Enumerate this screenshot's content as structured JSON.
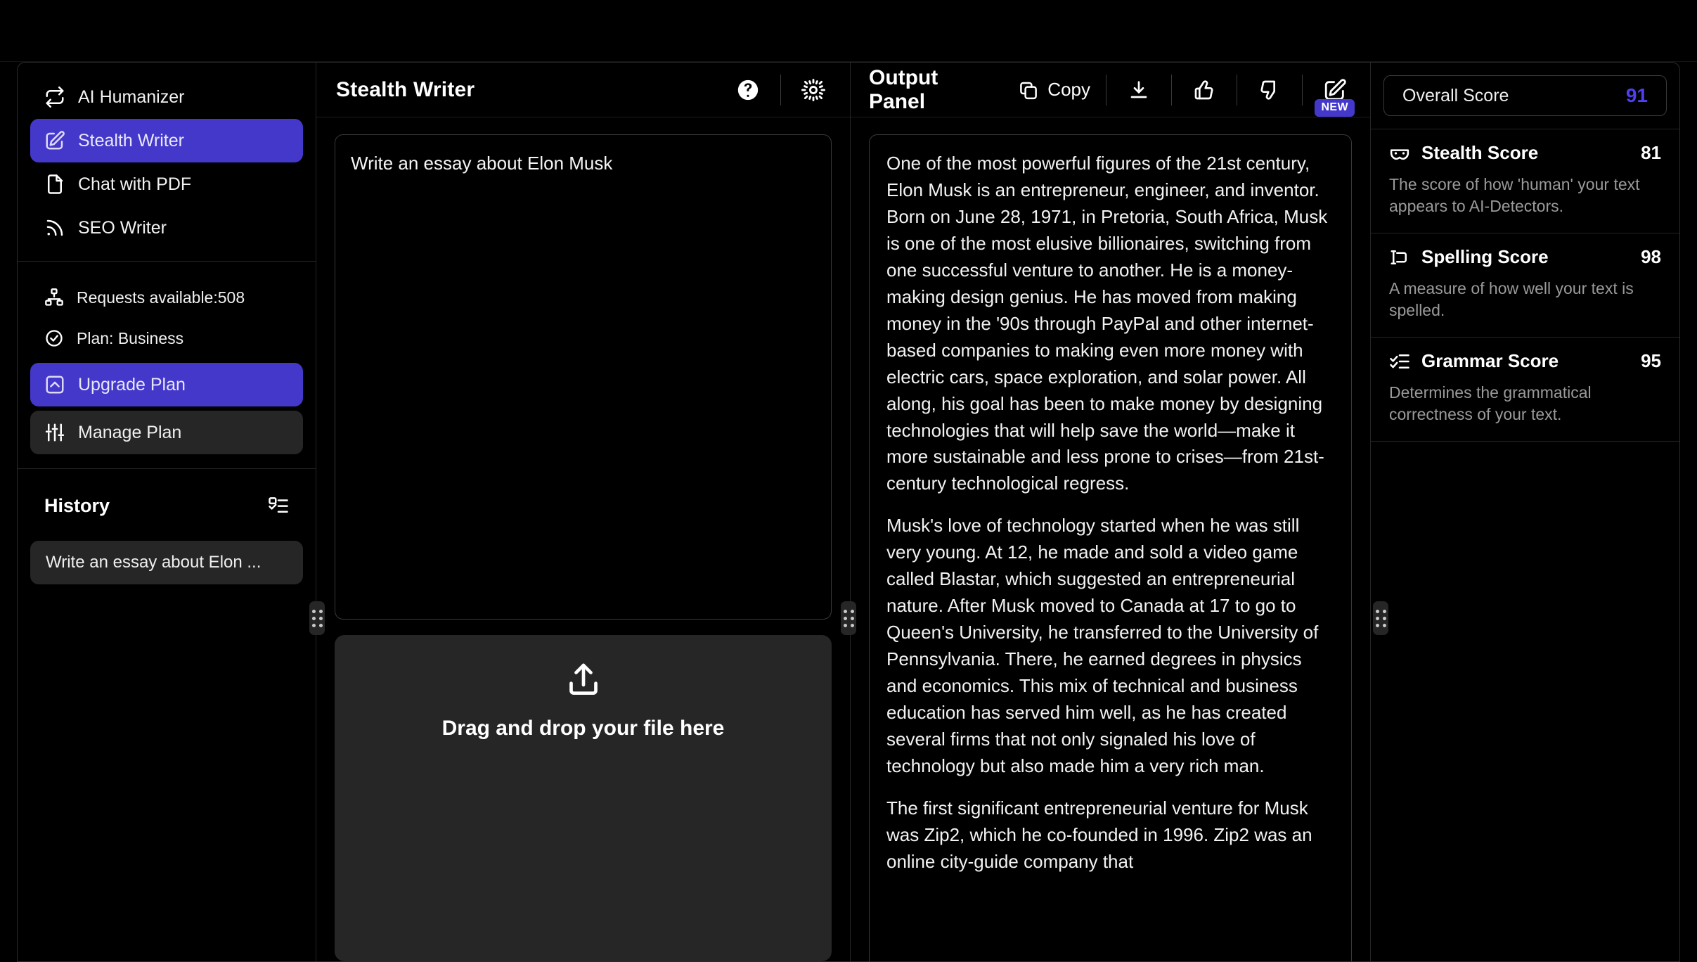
{
  "sidebar": {
    "nav_items": [
      {
        "label": "AI Humanizer",
        "icon": "repeat-icon",
        "active": false
      },
      {
        "label": "Stealth Writer",
        "icon": "edit-square-icon",
        "active": true
      },
      {
        "label": "Chat with PDF",
        "icon": "file-icon",
        "active": false
      },
      {
        "label": "SEO Writer",
        "icon": "rss-icon",
        "active": false
      }
    ],
    "meta_items": [
      {
        "label": "Requests available:508",
        "icon": "network-icon"
      },
      {
        "label": "Plan: Business",
        "icon": "check-circle-icon"
      }
    ],
    "upgrade_label": "Upgrade Plan",
    "manage_label": "Manage Plan",
    "history": {
      "title": "History",
      "list_icon": "list-check-icon",
      "items": [
        {
          "label": "Write an essay about Elon ..."
        }
      ]
    }
  },
  "middle": {
    "title": "Stealth Writer",
    "help_icon": "help-circle-icon",
    "settings_icon": "gear-icon",
    "input_value": "Write an essay about Elon Musk",
    "input_placeholder": "Write an essay about Elon Musk",
    "dropzone_label": "Drag and drop your file here",
    "dropzone_icon": "upload-icon"
  },
  "output": {
    "title": "Output Panel",
    "copy_label": "Copy",
    "copy_icon": "copy-icon",
    "download_icon": "download-icon",
    "thumbs_up_icon": "thumbs-up-icon",
    "thumbs_down_icon": "thumbs-down-icon",
    "edit_icon": "edit-square-icon",
    "new_badge": "NEW",
    "paragraphs": [
      "One of the most powerful figures of the 21st century, Elon Musk is an entrepreneur, engineer, and inventor. Born on June 28, 1971, in Pretoria, South Africa, Musk is one of the most elusive billionaires, switching from one successful venture to another. He is a money-making design genius. He has moved from making money in the '90s through PayPal and other internet-based companies to making even more money with electric cars, space exploration, and solar power. All along, his goal has been to make money by designing technologies that will help save the world—make it more sustainable and less prone to crises—from 21st-century technological regress.",
      "Musk's love of technology started when he was still very young. At 12, he made and sold a video game called Blastar, which suggested an entrepreneurial nature. After Musk moved to Canada at 17 to go to Queen's University, he transferred to the University of Pennsylvania. There, he earned degrees in physics and economics. This mix of technical and business education has served him well, as he has created several firms that not only signaled his love of technology but also made him a very rich man.",
      "The first significant entrepreneurial venture for Musk was Zip2, which he co-founded in 1996. Zip2 was an online city-guide company that"
    ]
  },
  "scores": {
    "overall_label": "Overall Score",
    "overall_value": "91",
    "overall_color": "#4e3ff0",
    "items": [
      {
        "name": "Stealth Score",
        "value": "81",
        "icon": "mask-icon",
        "description": "The score of how 'human' your text appears to AI-Detectors."
      },
      {
        "name": "Spelling Score",
        "value": "98",
        "icon": "spellcheck-icon",
        "description": "A measure of how well your text is spelled."
      },
      {
        "name": "Grammar Score",
        "value": "95",
        "icon": "list-check-icon",
        "description": "Determines the grammatical correctness of your text."
      }
    ]
  },
  "theme": {
    "accent": "#4438ca",
    "background": "#000000",
    "surface": "#262626",
    "border": "#3a3a3a"
  }
}
